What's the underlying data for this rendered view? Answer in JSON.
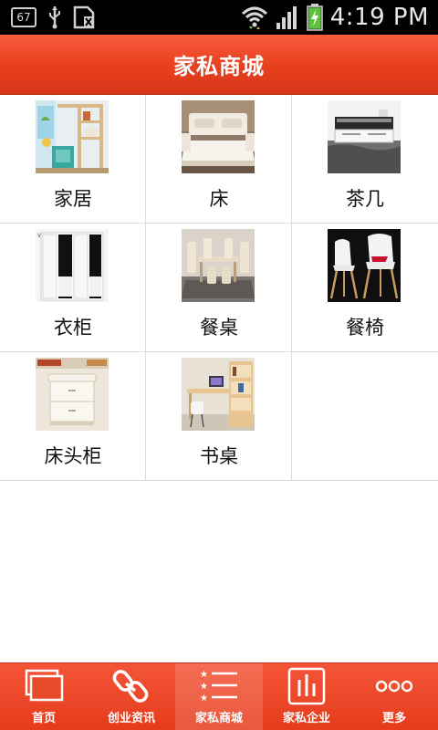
{
  "status_bar": {
    "badge": "67",
    "time": "4:19 PM",
    "icons": [
      "usb-icon",
      "sim-card-icon",
      "wifi-icon",
      "signal-icon",
      "battery-charging-icon"
    ]
  },
  "header": {
    "title": "家私商城"
  },
  "grid": {
    "items": [
      {
        "label": "家居",
        "image": "living-room-photo"
      },
      {
        "label": "床",
        "image": "bed-photo"
      },
      {
        "label": "茶几",
        "image": "coffee-table-photo"
      },
      {
        "label": "衣柜",
        "image": "wardrobe-photo"
      },
      {
        "label": "餐桌",
        "image": "dining-table-photo"
      },
      {
        "label": "餐椅",
        "image": "dining-chair-photo"
      },
      {
        "label": "床头柜",
        "image": "nightstand-photo"
      },
      {
        "label": "书桌",
        "image": "desk-photo"
      }
    ]
  },
  "tabbar": {
    "active": "家私商城",
    "tabs": [
      {
        "label": "首页",
        "icon": "home-pages-icon"
      },
      {
        "label": "创业资讯",
        "icon": "link-icon"
      },
      {
        "label": "家私商城",
        "icon": "list-icon"
      },
      {
        "label": "家私企业",
        "icon": "chart-icon"
      },
      {
        "label": "更多",
        "icon": "more-dots-icon"
      }
    ]
  },
  "colors": {
    "accent": "#e8401f",
    "header_top": "#f75a3c"
  }
}
